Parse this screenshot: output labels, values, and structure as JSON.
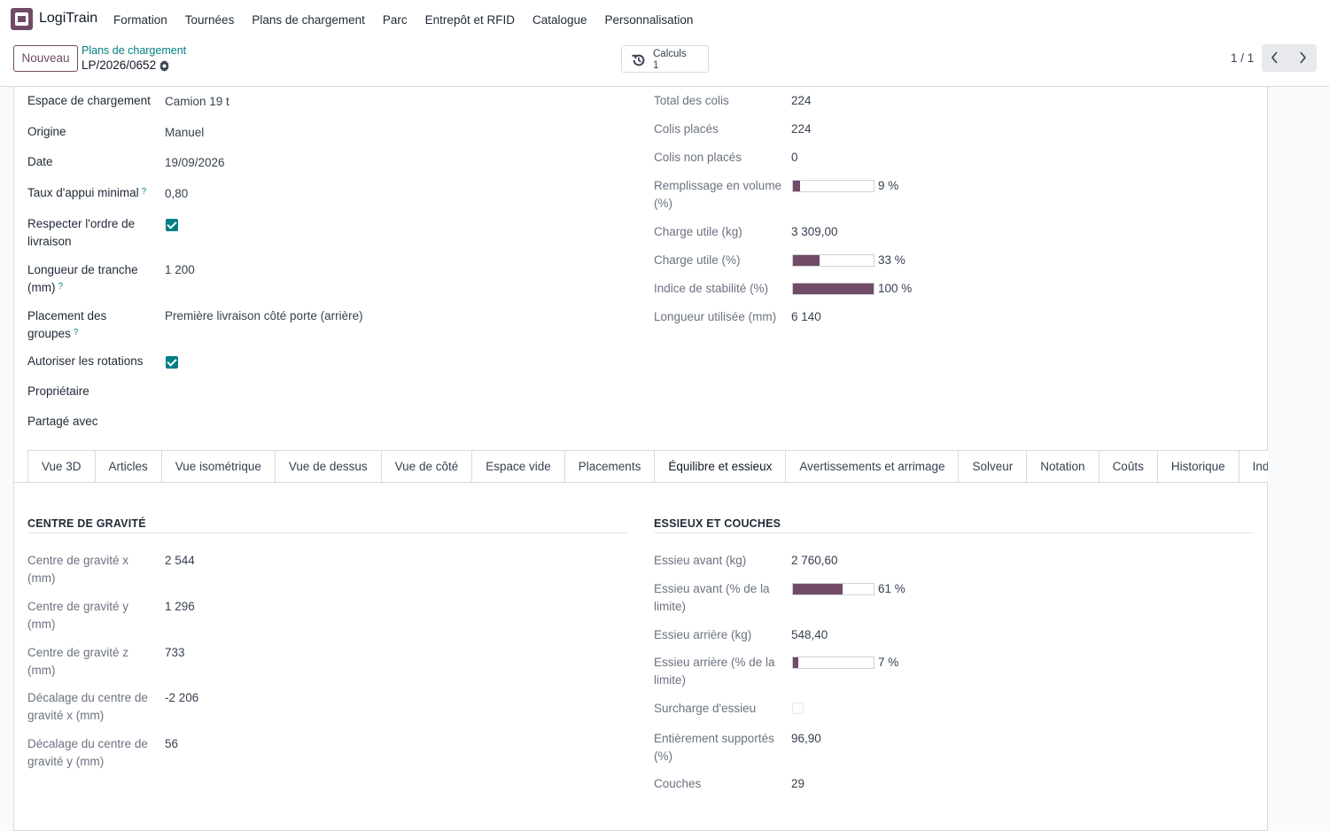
{
  "app": {
    "name": "LogiTrain"
  },
  "menu": [
    "Formation",
    "Tournées",
    "Plans de chargement",
    "Parc",
    "Entrepôt et RFID",
    "Catalogue",
    "Personnalisation"
  ],
  "control": {
    "new_label": "Nouveau",
    "breadcrumb_parent": "Plans de chargement",
    "breadcrumb_current": "LP/2026/0652",
    "calc_label": "Calculs",
    "calc_value": "1",
    "pager": "1 / 1"
  },
  "left_fields": {
    "espace_label": "Espace de chargement",
    "espace_value": "Camion 19 t",
    "origine_label": "Origine",
    "origine_value": "Manuel",
    "date_label": "Date",
    "date_value": "19/09/2026",
    "taux_label": "Taux d'appui minimal",
    "taux_value": "0,80",
    "respecter_label": "Respecter l'ordre de livraison",
    "respecter_checked": true,
    "longueur_label": "Longueur de tranche (mm)",
    "longueur_value": "1 200",
    "placement_label": "Placement des groupes",
    "placement_value": "Première livraison côté porte (arrière)",
    "rotations_label": "Autoriser les rotations",
    "rotations_checked": true,
    "proprietaire_label": "Propriétaire",
    "partage_label": "Partagé avec",
    "help_mark": "?"
  },
  "right_fields": {
    "total_label": "Total des colis",
    "total_value": "224",
    "places_label": "Colis placés",
    "places_value": "224",
    "non_places_label": "Colis non placés",
    "non_places_value": "0",
    "volume_label": "Remplissage en volume (%)",
    "volume_text": "9 %",
    "volume_pct": 9,
    "charge_kg_label": "Charge utile (kg)",
    "charge_kg_value": "3 309,00",
    "charge_pct_label": "Charge utile (%)",
    "charge_pct_text": "33 %",
    "charge_pct": 33,
    "stabilite_label": "Indice de stabilité (%)",
    "stabilite_text": "100 %",
    "stabilite_pct": 100,
    "longueur_util_label": "Longueur utilisée (mm)",
    "longueur_util_value": "6 140"
  },
  "tabs": [
    "Vue 3D",
    "Articles",
    "Vue isométrique",
    "Vue de dessus",
    "Vue de côté",
    "Espace vide",
    "Placements",
    "Équilibre et essieux",
    "Avertissements et arrimage",
    "Solveur",
    "Notation",
    "Coûts",
    "Historique",
    "Indicateurs"
  ],
  "active_tab": "Équilibre et essieux",
  "cog": {
    "title": "CENTRE DE GRAVITÉ",
    "x_label": "Centre de gravité x (mm)",
    "x_value": "2 544",
    "y_label": "Centre de gravité y (mm)",
    "y_value": "1 296",
    "z_label": "Centre de gravité z (mm)",
    "z_value": "733",
    "dx_label": "Décalage du centre de gravité x (mm)",
    "dx_value": "-2 206",
    "dy_label": "Décalage du centre de gravité y (mm)",
    "dy_value": "56"
  },
  "axles": {
    "title": "ESSIEUX ET COUCHES",
    "avant_kg_label": "Essieu avant (kg)",
    "avant_kg_value": "2 760,60",
    "avant_pct_label": "Essieu avant (% de la limite)",
    "avant_pct_text": "61 %",
    "avant_pct": 61,
    "arriere_kg_label": "Essieu arrière (kg)",
    "arriere_kg_value": "548,40",
    "arriere_pct_label": "Essieu arrière (% de la limite)",
    "arriere_pct_text": "7 %",
    "arriere_pct": 7,
    "surcharge_label": "Surcharge d'essieu",
    "surcharge_checked": false,
    "supportes_label": "Entièrement supportés (%)",
    "supportes_value": "96,90",
    "couches_label": "Couches",
    "couches_value": "29"
  },
  "colors": {
    "brand": "#714B67",
    "accent": "#017e84"
  }
}
